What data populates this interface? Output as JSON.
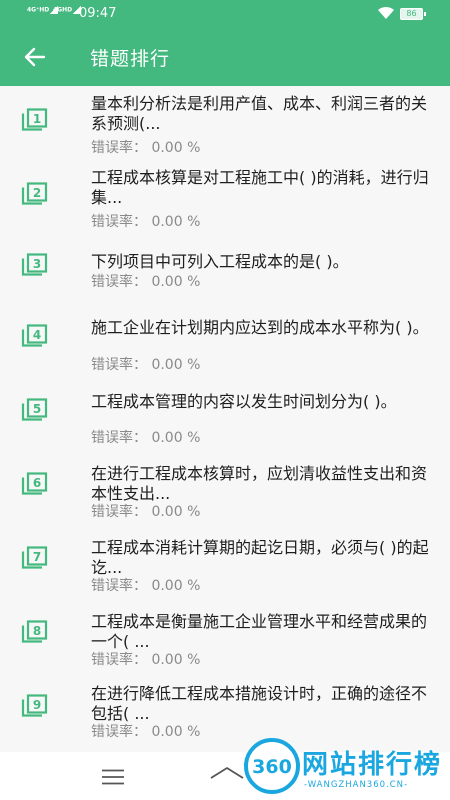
{
  "status_bar": {
    "signal_1": "4G⁺HD",
    "signal_2": "4GHD",
    "time": "09:47",
    "battery": "86"
  },
  "app_bar": {
    "back_icon": "arrow-left-icon",
    "title": "错题排行"
  },
  "questions": [
    {
      "number": "1",
      "text": "量本利分析法是利用产值、成本、利润三者的关系预测(...",
      "rate_label": "错误率：",
      "rate_value": "0.00 %"
    },
    {
      "number": "2",
      "text": "工程成本核算是对工程施工中( )的消耗，进行归集...",
      "rate_label": "错误率：",
      "rate_value": "0.00 %"
    },
    {
      "number": "3",
      "text": "下列项目中可列入工程成本的是( )。",
      "rate_label": "错误率：",
      "rate_value": "0.00 %"
    },
    {
      "number": "4",
      "text": "施工企业在计划期内应达到的成本水平称为( )。",
      "rate_label": "错误率：",
      "rate_value": "0.00 %"
    },
    {
      "number": "5",
      "text": "工程成本管理的内容以发生时间划分为( )。",
      "rate_label": "错误率：",
      "rate_value": "0.00 %"
    },
    {
      "number": "6",
      "text": "在进行工程成本核算时，应划清收益性支出和资本性支出...",
      "rate_label": "错误率：",
      "rate_value": "0.00 %"
    },
    {
      "number": "7",
      "text": "工程成本消耗计算期的起讫日期，必须与( )的起讫...",
      "rate_label": "错误率：",
      "rate_value": "0.00 %"
    },
    {
      "number": "8",
      "text": "工程成本是衡量施工企业管理水平和经营成果的一个( ...",
      "rate_label": "错误率：",
      "rate_value": "0.00 %"
    },
    {
      "number": "9",
      "text": "在进行降低工程成本措施设计时，正确的途径不包括( ...",
      "rate_label": "错误率：",
      "rate_value": "0.00 %"
    }
  ],
  "bottom_bar": {
    "menu_icon": "hamburger-menu-icon",
    "home_icon": "home-icon"
  },
  "watermark": {
    "logo": "360",
    "name": "网站排行榜",
    "url": "-WANGZHAN360.CN-"
  },
  "colors": {
    "primary": "#43b97f",
    "text": "#1e1e1e",
    "secondary_text": "#8a8a8a",
    "background": "#f7f7f7"
  }
}
